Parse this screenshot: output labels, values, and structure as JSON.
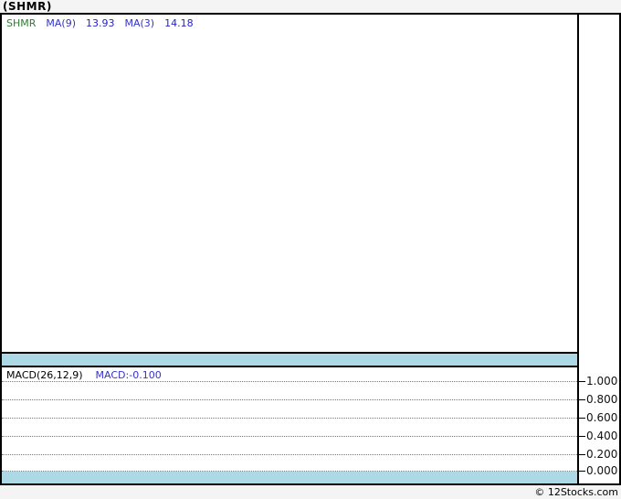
{
  "page": {
    "title": "(SHMR)",
    "footer": "© 12Stocks.com"
  },
  "colors": {
    "band": "#add8e6",
    "ticker_green": "#2e7d32",
    "indicator_blue": "#3333cc",
    "value_blue": "#2222cc",
    "grid_gray": "#777777",
    "page_bg": "#f4f4f4"
  },
  "price_panel": {
    "legend": {
      "ticker": "SHMR",
      "ma9_label": "MA(9)",
      "ma9_value": "13.93",
      "ma3_label": "MA(3)",
      "ma3_value": "14.18"
    }
  },
  "macd_panel": {
    "legend_label": "MACD(26,12,9)",
    "legend_value": "MACD:-0.100",
    "axis_ticks": [
      "1.000",
      "0.800",
      "0.600",
      "0.400",
      "0.200",
      "0.000"
    ]
  },
  "chart_data": [
    {
      "type": "line",
      "panel": "price",
      "title": "(SHMR)",
      "series": [
        {
          "name": "SHMR",
          "values": []
        },
        {
          "name": "MA(9)",
          "last_value": 13.93,
          "values": []
        },
        {
          "name": "MA(3)",
          "last_value": 14.18,
          "values": []
        }
      ],
      "note": "price panel is empty - no plotted candles or lines visible",
      "grid": "off",
      "legend_position": "top-left"
    },
    {
      "type": "line",
      "panel": "MACD(26,12,9)",
      "series": [
        {
          "name": "MACD",
          "last_value": -0.1,
          "values": []
        }
      ],
      "ylabel": "",
      "ylim": [
        -0.1,
        1.1
      ],
      "yticks": [
        1.0,
        0.8,
        0.6,
        0.4,
        0.2,
        0.0
      ],
      "grid": "dotted horizontal gridlines at each ytick",
      "legend_position": "top-left",
      "note": "no MACD line/histogram visible; light-blue band below 0.000 level"
    }
  ]
}
